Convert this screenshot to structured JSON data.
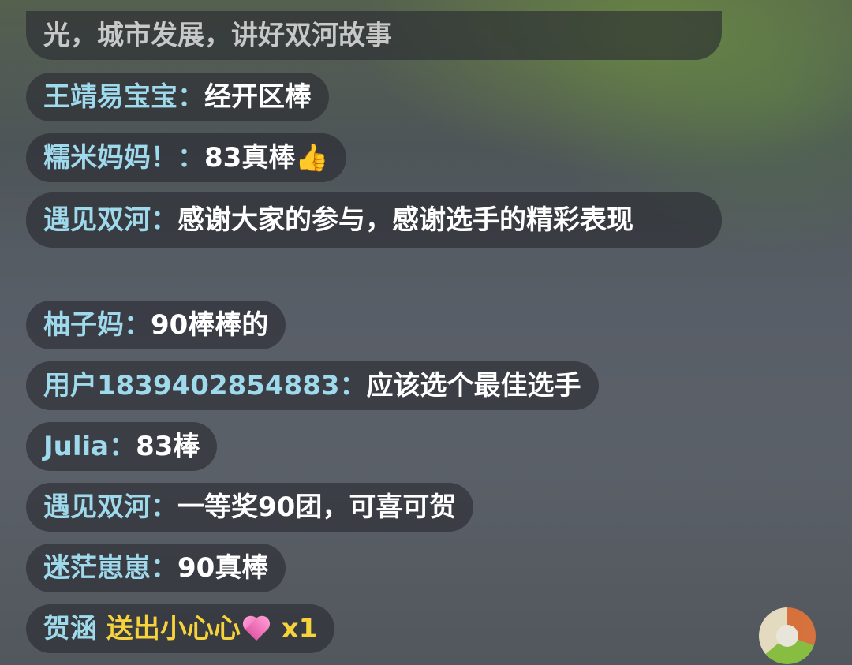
{
  "comments": [
    {
      "user": "",
      "text": "光，城市发展，讲好双河故事"
    },
    {
      "user": "王靖易宝宝：",
      "text": "经开区棒"
    },
    {
      "user": "糯米妈妈！：",
      "text": "83真棒",
      "icon": "thumbs-up-icon",
      "icon_glyph": "👍"
    },
    {
      "user": "遇见双河：",
      "text": "感谢大家的参与，感谢选手的精彩表现"
    },
    {
      "user": "柚子妈：",
      "text": "90棒棒的"
    },
    {
      "user": "用户1839402854883：",
      "text": "应该选个最佳选手"
    },
    {
      "user": "Julia：",
      "text": "83棒"
    },
    {
      "user": "遇见双河：",
      "text": "一等奖90团，可喜可贺"
    },
    {
      "user": "迷茫崽崽：",
      "text": "90真棒"
    },
    {
      "user": "贺涵",
      "gift_text": "送出小心心",
      "gift_icon": "heart-icon",
      "gift_count": "x1"
    }
  ],
  "colors": {
    "username": "#9fd9ec",
    "gift": "#f6d33c",
    "message": "#ffffff",
    "bubble": "rgba(40,42,48,0.62)"
  }
}
